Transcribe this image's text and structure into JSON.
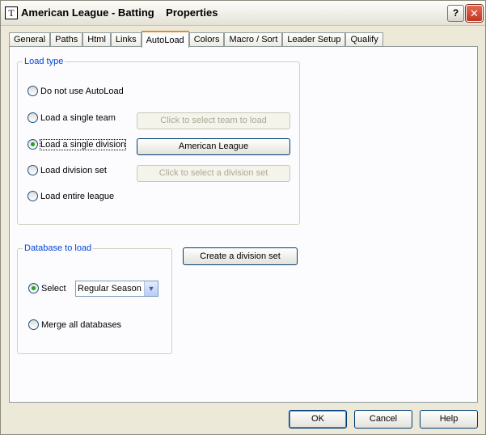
{
  "window": {
    "title": "American League - Batting    Properties",
    "icon_glyph": "T",
    "help_glyph": "?",
    "close_glyph": "✕"
  },
  "tabs": [
    {
      "label": "General",
      "active": false
    },
    {
      "label": "Paths",
      "active": false
    },
    {
      "label": "Html",
      "active": false
    },
    {
      "label": "Links",
      "active": false
    },
    {
      "label": "AutoLoad",
      "active": true
    },
    {
      "label": "Colors",
      "active": false
    },
    {
      "label": "Macro / Sort",
      "active": false
    },
    {
      "label": "Leader Setup",
      "active": false
    },
    {
      "label": "Qualify",
      "active": false
    }
  ],
  "load_type": {
    "legend": "Load type",
    "options": [
      {
        "label": "Do not use AutoLoad",
        "checked": false
      },
      {
        "label": "Load a single team",
        "checked": false
      },
      {
        "label": "Load a single division",
        "checked": true
      },
      {
        "label": "Load division set",
        "checked": false
      },
      {
        "label": "Load entire league",
        "checked": false
      }
    ],
    "select_team_button": "Click to select team to load",
    "division_button": "American League",
    "select_division_set_button": "Click to select a division set"
  },
  "database": {
    "legend": "Database to load",
    "select_label": "Select",
    "select_checked": true,
    "select_value": "Regular Season",
    "merge_label": "Merge all databases",
    "merge_checked": false
  },
  "create_division_set_button": "Create a division set",
  "footer": {
    "ok": "OK",
    "cancel": "Cancel",
    "help": "Help"
  },
  "colors": {
    "legend_text": "#0046d5",
    "active_tab_accent": "#e68b2c",
    "radio_dot": "#21a121"
  }
}
